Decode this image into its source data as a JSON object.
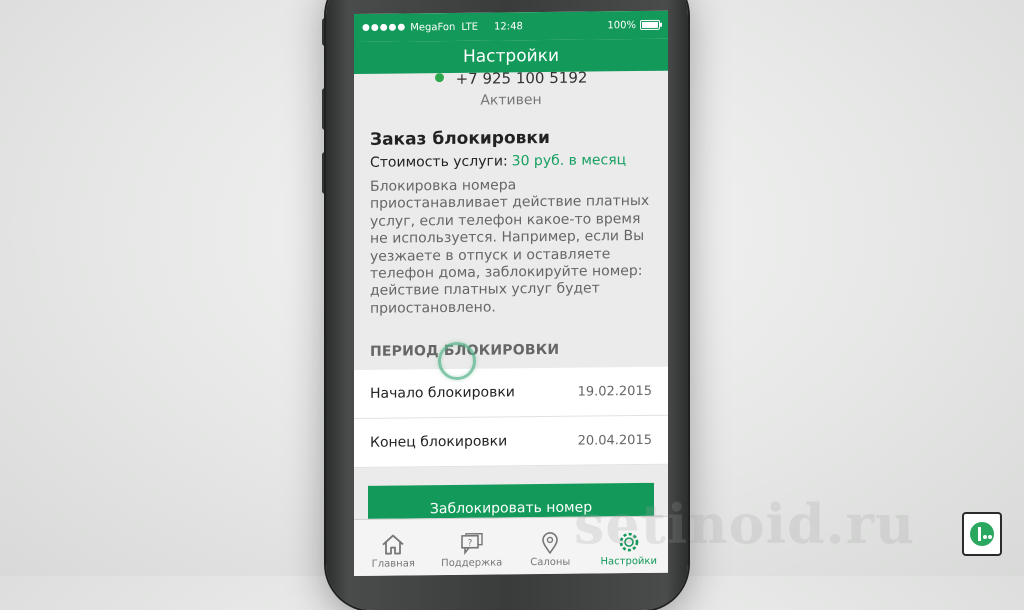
{
  "status_bar": {
    "signal": "●●●●●",
    "carrier": "MegaFon",
    "network": "LTE",
    "time": "12:48",
    "battery": "100%"
  },
  "nav": {
    "title": "Настройки"
  },
  "account": {
    "phone": "+7 925 100 5192",
    "status": "Активен"
  },
  "service": {
    "title": "Заказ блокировки",
    "price_label": "Стоимость услуги:",
    "price_value": "30 руб. в месяц",
    "description": "Блокировка номера приостанавливает действие платных услуг, если телефон какое-то время не используется. Например, если Вы уезжаете в отпуск и оставляете телефон дома, заблокируйте номер: действие платных услуг будет приостановлено."
  },
  "period": {
    "header": "ПЕРИОД БЛОКИРОВКИ",
    "rows": [
      {
        "label": "Начало блокировки",
        "value": "19.02.2015"
      },
      {
        "label": "Конец блокировки",
        "value": "20.04.2015"
      }
    ]
  },
  "action_button": "Заблокировать номер",
  "tabs": [
    {
      "label": "Главная",
      "icon": "home-icon"
    },
    {
      "label": "Поддержка",
      "icon": "support-chat-icon"
    },
    {
      "label": "Салоны",
      "icon": "map-pin-icon"
    },
    {
      "label": "Настройки",
      "icon": "gear-icon",
      "active": true
    }
  ],
  "watermark": "setinoid.ru",
  "colors": {
    "accent": "#139a5a",
    "price": "#16a060"
  }
}
